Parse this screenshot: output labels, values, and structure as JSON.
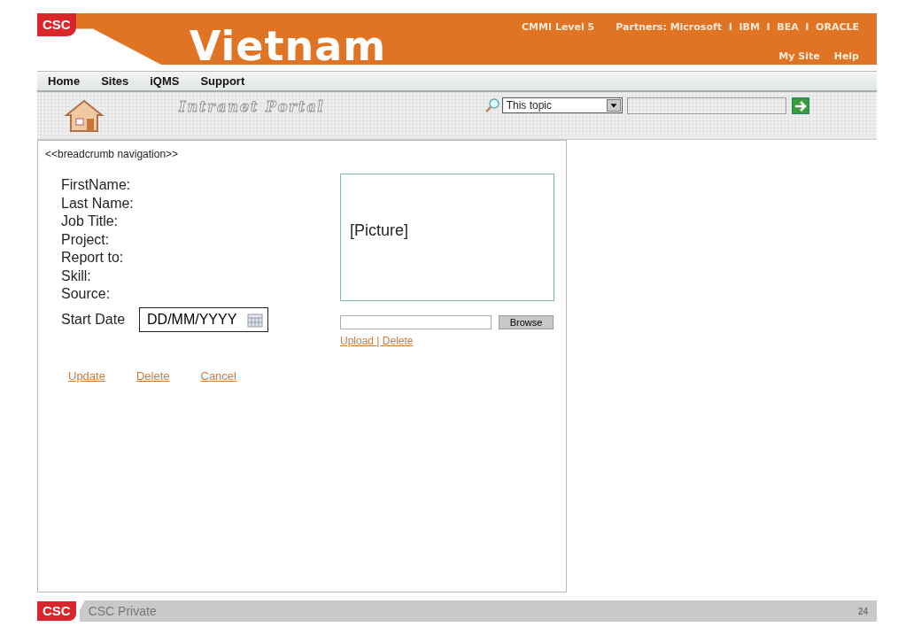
{
  "header": {
    "logo": "CSC",
    "title": "Vietnam",
    "cmmi": "CMMI Level 5",
    "partners": "Partners: Microsoft  I  IBM  I  BEA  I  ORACLE",
    "links": [
      "My Site",
      "Help"
    ]
  },
  "nav": [
    "Home",
    "Sites",
    "iQMS",
    "Support"
  ],
  "portal": {
    "title": "Intranet Portal",
    "scope": "This topic"
  },
  "content": {
    "breadcrumb": "<<breadcrumb navigation>>",
    "fields": [
      "FirstName:",
      "Last Name:",
      "Job Title:",
      "Project:",
      "Report to:",
      "Skill:",
      "Source:"
    ],
    "start_date": {
      "label": "Start Date",
      "placeholder": "DD/MM/YYYY"
    },
    "picture": "[Picture]",
    "browse": "Browse",
    "upload_links": "Upload | Delete",
    "actions": [
      "Update",
      "Delete",
      "Cancel"
    ]
  },
  "footer": {
    "logo": "CSC",
    "label": "CSC Private",
    "page": "24"
  }
}
